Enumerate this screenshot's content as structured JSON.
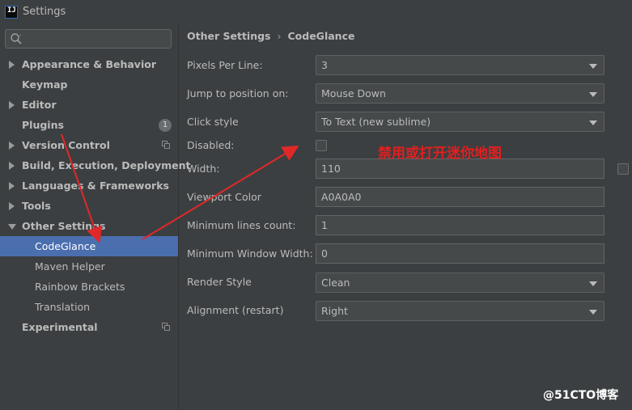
{
  "window": {
    "title": "Settings",
    "app_icon_letter": "IJ"
  },
  "search": {
    "placeholder": ""
  },
  "sidebar": {
    "items": [
      {
        "label": "Appearance & Behavior",
        "expandable": true,
        "expanded": false
      },
      {
        "label": "Keymap",
        "expandable": false
      },
      {
        "label": "Editor",
        "expandable": true,
        "expanded": false
      },
      {
        "label": "Plugins",
        "expandable": false,
        "badge": "1"
      },
      {
        "label": "Version Control",
        "expandable": true,
        "expanded": false,
        "copy_icon": true
      },
      {
        "label": "Build, Execution, Deployment",
        "expandable": true,
        "expanded": false
      },
      {
        "label": "Languages & Frameworks",
        "expandable": true,
        "expanded": false
      },
      {
        "label": "Tools",
        "expandable": true,
        "expanded": false
      },
      {
        "label": "Other Settings",
        "expandable": true,
        "expanded": true
      },
      {
        "label": "CodeGlance",
        "child": true,
        "selected": true
      },
      {
        "label": "Maven Helper",
        "child": true
      },
      {
        "label": "Rainbow Brackets",
        "child": true
      },
      {
        "label": "Translation",
        "child": true
      },
      {
        "label": "Experimental",
        "expandable": false,
        "copy_icon": true
      }
    ]
  },
  "breadcrumb": {
    "parent": "Other Settings",
    "separator": "›",
    "current": "CodeGlance"
  },
  "settings": {
    "pixels_per_line": {
      "label": "Pixels Per Line:",
      "value": "3"
    },
    "jump_to_position": {
      "label": "Jump to position on:",
      "value": "Mouse Down"
    },
    "click_style": {
      "label": "Click style",
      "value": "To Text (new sublime)"
    },
    "disabled": {
      "label": "Disabled:",
      "checked": false
    },
    "width": {
      "label": "Width:",
      "value": "110"
    },
    "viewport_color": {
      "label": "Viewport Color",
      "value": "A0A0A0"
    },
    "min_lines_count": {
      "label": "Minimum lines count:",
      "value": "1"
    },
    "min_window_width": {
      "label": "Minimum Window Width:",
      "value": "0"
    },
    "render_style": {
      "label": "Render Style",
      "value": "Clean"
    },
    "alignment": {
      "label": "Alignment (restart)",
      "value": "Right"
    }
  },
  "annotation": {
    "text": "禁用或打开迷你地图",
    "color": "#e51e1e"
  },
  "watermark": {
    "text": "@51CTO博客"
  },
  "colors": {
    "background": "#3c3f41",
    "selection": "#4b6eaf",
    "field_bg": "#45494a",
    "arrow": "#e02828"
  }
}
